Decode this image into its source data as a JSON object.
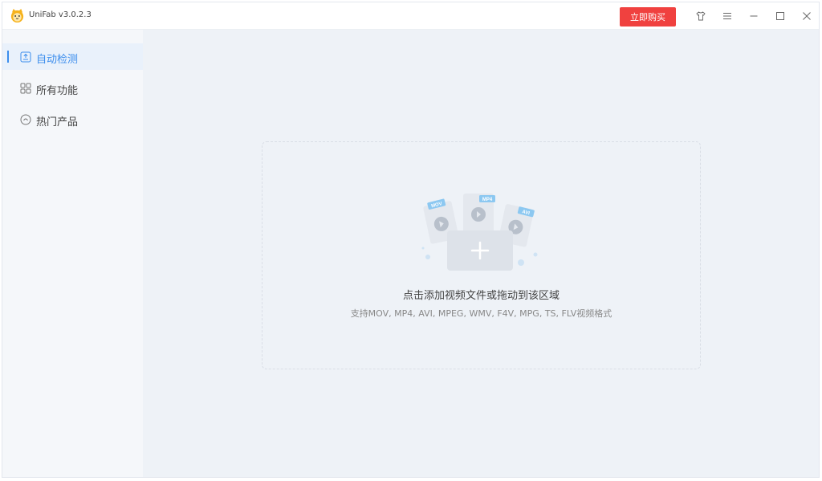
{
  "app": {
    "title": "UniFab v3.0.2.3"
  },
  "titlebar": {
    "buy_label": "立即购买",
    "icons": [
      "shirt-icon",
      "menu-icon",
      "minimize-icon",
      "maximize-icon",
      "close-icon"
    ]
  },
  "sidebar": {
    "items": [
      {
        "label": "自动检测",
        "icon": "auto-detect-icon",
        "active": true
      },
      {
        "label": "所有功能",
        "icon": "grid-icon",
        "active": false
      },
      {
        "label": "热门产品",
        "icon": "hot-icon",
        "active": false
      }
    ]
  },
  "dropzone": {
    "title": "点击添加视频文件或拖动到该区域",
    "subtitle": "支持MOV, MP4, AVI, MPEG, WMV, F4V, MPG, TS, FLV视频格式",
    "file_badges": [
      "MOV",
      "MP4",
      "AVI"
    ]
  },
  "colors": {
    "accent": "#3b8ded",
    "buy": "#f0413f",
    "sidebar_bg": "#f5f7fa",
    "main_bg": "#eef2f7"
  }
}
